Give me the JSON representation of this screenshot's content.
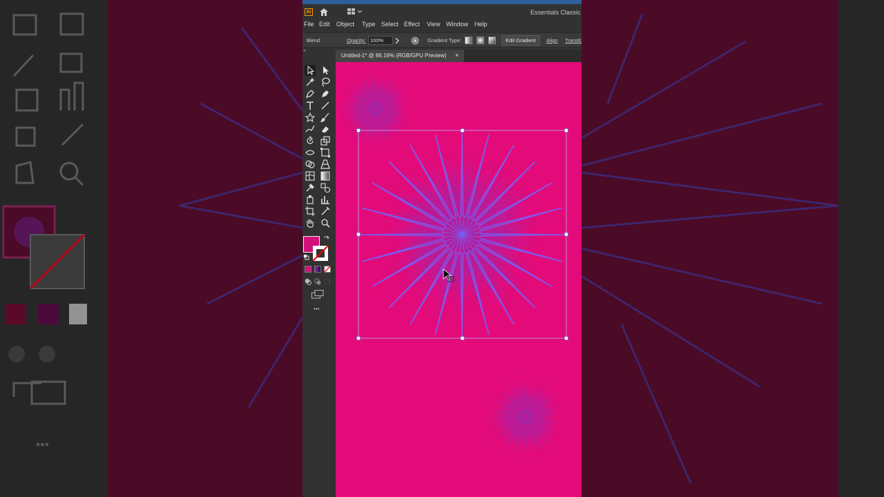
{
  "app": {
    "logo": "Ai",
    "workspace": "Essentials Classic"
  },
  "menu": [
    "File",
    "Edit",
    "Object",
    "Type",
    "Select",
    "Effect",
    "View",
    "Window",
    "Help"
  ],
  "control_bar": {
    "object_label": "Blend",
    "opacity_label": "Opacity:",
    "opacity_value": "100%",
    "gradient_type_label": "Gradient Type:",
    "edit_gradient_label": "Edit Gradient",
    "align_label": "Align",
    "transform_label": "Transform"
  },
  "document": {
    "tab_title": "Untitled-1* @ 86.16% (RGB/GPU Preview)",
    "close_glyph": "×"
  },
  "toolbox": {
    "collapse_glyph": "«",
    "more_glyph": "•••"
  },
  "colors": {
    "canvas": "#e30b79",
    "starburst": "#7b5cf0",
    "blur_flower": "#8a2fb8",
    "fill_swatch": "#d3117a",
    "selection": "#ffffff"
  }
}
